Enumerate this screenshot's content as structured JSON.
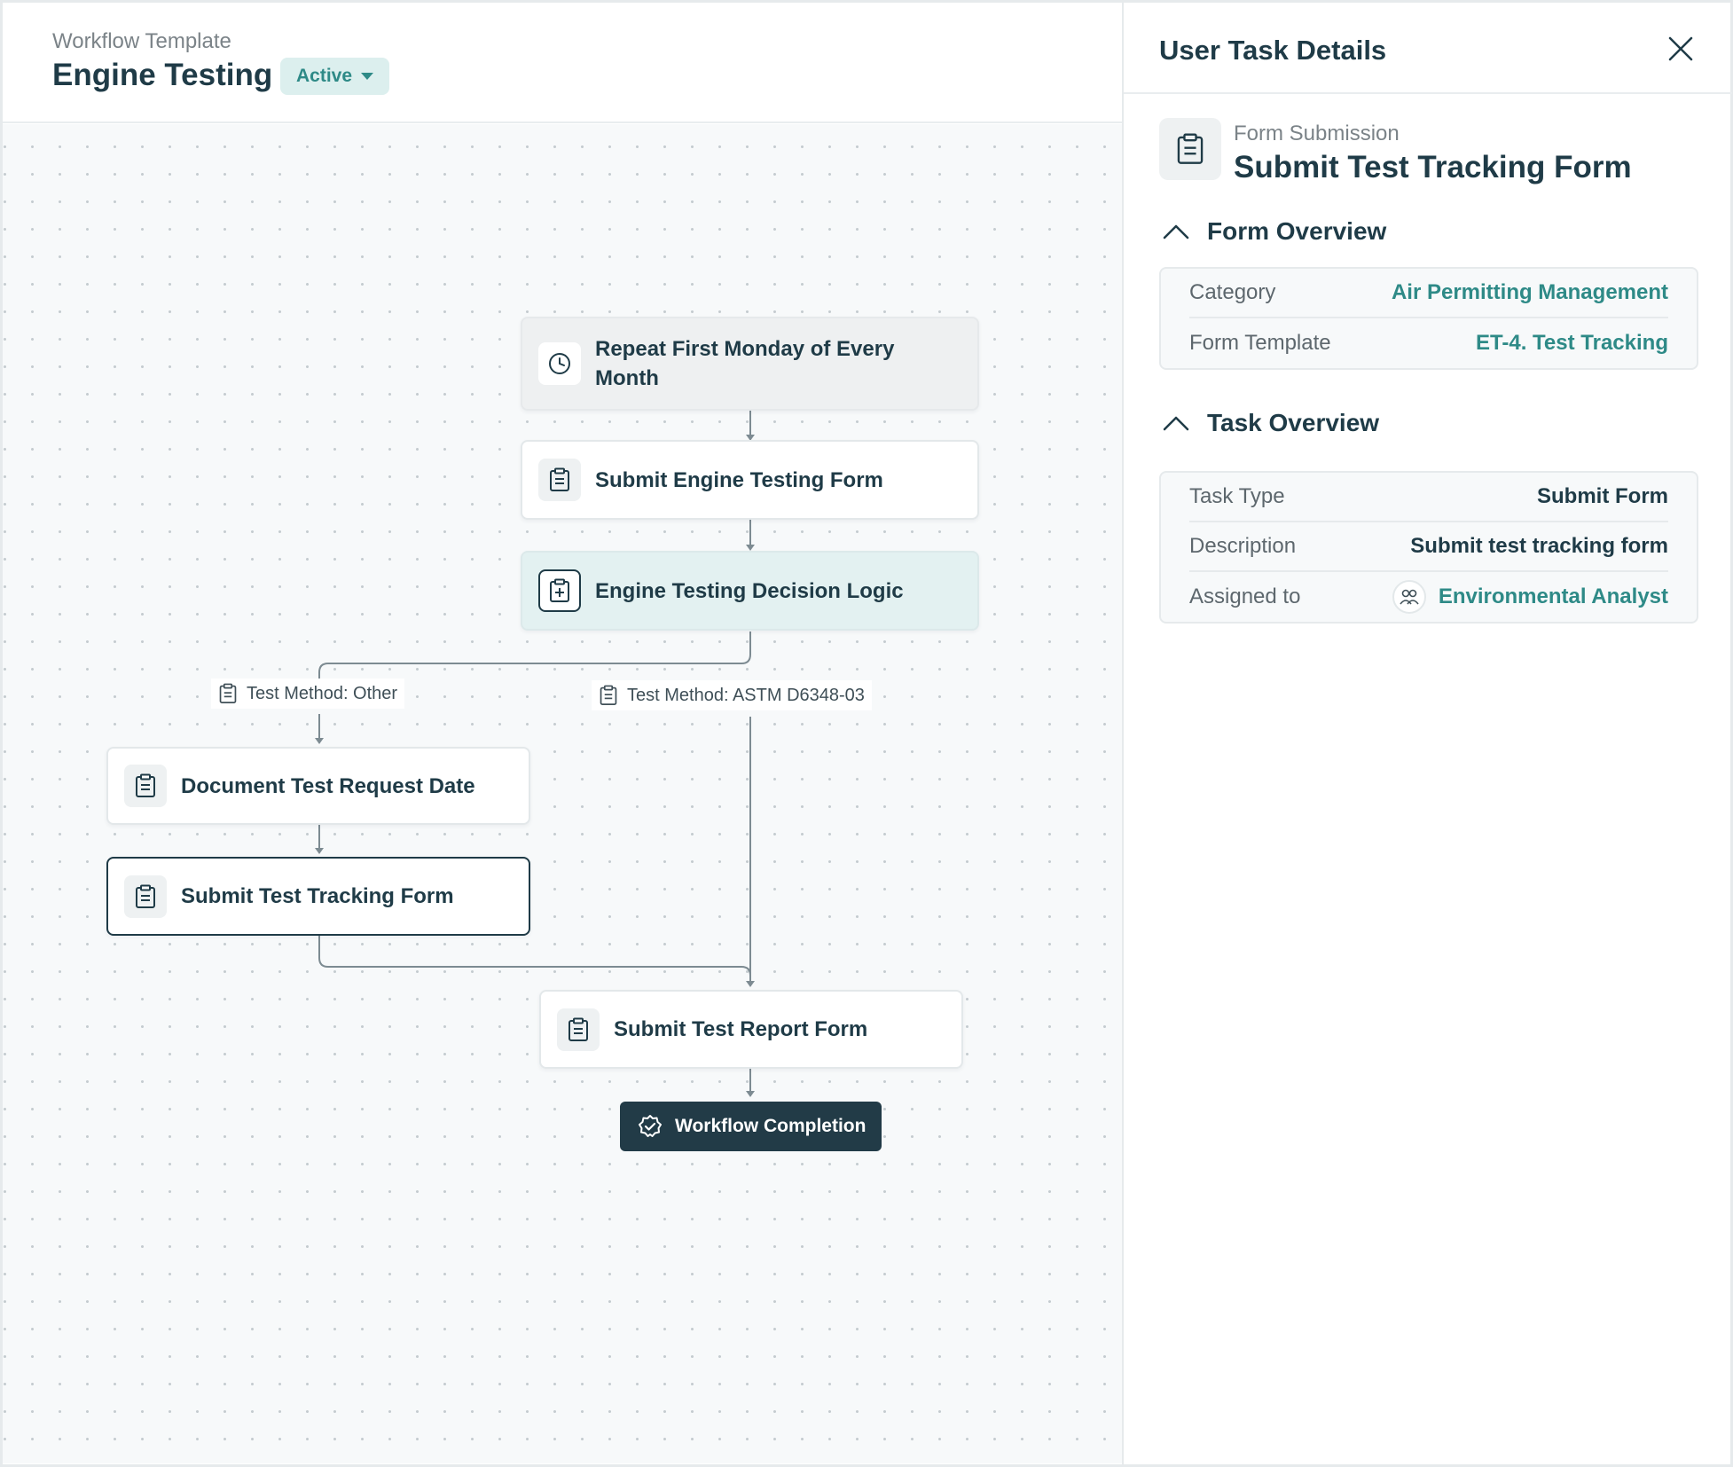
{
  "header": {
    "subtitle": "Workflow Template",
    "title": "Engine Testing",
    "status": "Active"
  },
  "workflow": {
    "nodes": [
      {
        "id": "trigger",
        "label": "Repeat First Monday of Every Month",
        "icon": "clock-icon"
      },
      {
        "id": "engine-form",
        "label": "Submit Engine Testing Form",
        "icon": "clipboard-icon"
      },
      {
        "id": "decision",
        "label": "Engine Testing Decision Logic",
        "icon": "decision-icon"
      },
      {
        "id": "request-date",
        "label": "Document Test Request Date",
        "icon": "clipboard-icon"
      },
      {
        "id": "tracking-form",
        "label": "Submit Test Tracking Form",
        "icon": "clipboard-icon"
      },
      {
        "id": "report-form",
        "label": "Submit Test Report Form",
        "icon": "clipboard-icon"
      }
    ],
    "branches": [
      {
        "label": "Test Method: Other"
      },
      {
        "label": "Test Method: ASTM D6348-03"
      }
    ],
    "completion": "Workflow Completion"
  },
  "panel": {
    "title": "User Task Details",
    "form_subtitle": "Form Submission",
    "form_title": "Submit Test Tracking Form",
    "form_overview": {
      "heading": "Form Overview",
      "rows": [
        {
          "key": "Category",
          "value": "Air Permitting Management"
        },
        {
          "key": "Form Template",
          "value": "ET-4. Test Tracking"
        }
      ]
    },
    "task_overview": {
      "heading": "Task Overview",
      "rows": [
        {
          "key": "Task Type",
          "value": "Submit Form"
        },
        {
          "key": "Description",
          "value": "Submit test tracking form"
        },
        {
          "key": "Assigned to",
          "value": "Environmental Analyst"
        }
      ]
    }
  },
  "colors": {
    "primary": "#1f3b47",
    "accent": "#2e8a87",
    "badge_bg": "#dcefee",
    "canvas_bg": "#f7f9fa"
  }
}
